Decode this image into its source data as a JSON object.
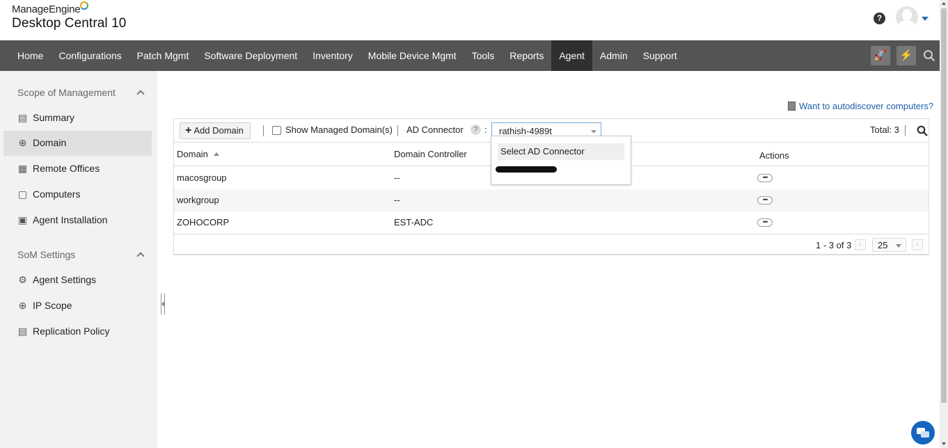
{
  "header": {
    "brand_top": "ManageEngine",
    "brand_main": "Desktop Central 10",
    "help_glyph": "?"
  },
  "nav": {
    "items": [
      "Home",
      "Configurations",
      "Patch Mgmt",
      "Software Deployment",
      "Inventory",
      "Mobile Device Mgmt",
      "Tools",
      "Reports",
      "Agent",
      "Admin",
      "Support"
    ],
    "active": "Agent",
    "rocket_glyph": "🚀",
    "bolt_glyph": "⚡"
  },
  "sidebar": {
    "section1": "Scope of Management",
    "items1": [
      {
        "label": "Summary",
        "icon": "summary-icon"
      },
      {
        "label": "Domain",
        "icon": "globe-icon"
      },
      {
        "label": "Remote Offices",
        "icon": "remote-offices-icon"
      },
      {
        "label": "Computers",
        "icon": "computers-icon"
      },
      {
        "label": "Agent Installation",
        "icon": "agent-installation-icon"
      }
    ],
    "section2": "SoM Settings",
    "items2": [
      {
        "label": "Agent Settings",
        "icon": "gear-icon"
      },
      {
        "label": "IP Scope",
        "icon": "ip-scope-icon"
      },
      {
        "label": "Replication Policy",
        "icon": "document-icon"
      }
    ]
  },
  "main": {
    "autodiscover_link": "Want to autodiscover computers?",
    "toolbar": {
      "add_domain": "Add Domain",
      "show_managed": "Show Managed Domain(s)",
      "ad_connector_label": "AD Connector",
      "help_glyph": "?",
      "colon": ":",
      "selected_connector": "rathish-4989t",
      "total": "Total: 3"
    },
    "table": {
      "columns": [
        "Domain",
        "Domain Controller",
        "Actions"
      ],
      "rows": [
        {
          "domain": "macosgroup",
          "controller": "--"
        },
        {
          "domain": "workgroup",
          "controller": "--"
        },
        {
          "domain": "ZOHOCORP",
          "controller": "EST-ADC"
        }
      ]
    },
    "pager": {
      "range": "1 - 3 of 3",
      "page_size": "25"
    },
    "dropdown": {
      "options": [
        "Select AD Connector"
      ]
    }
  },
  "colors": {
    "navbar": "#545454",
    "nav_active": "#2f2f2f",
    "link": "#1e5fa8",
    "chat": "#1565c0"
  }
}
